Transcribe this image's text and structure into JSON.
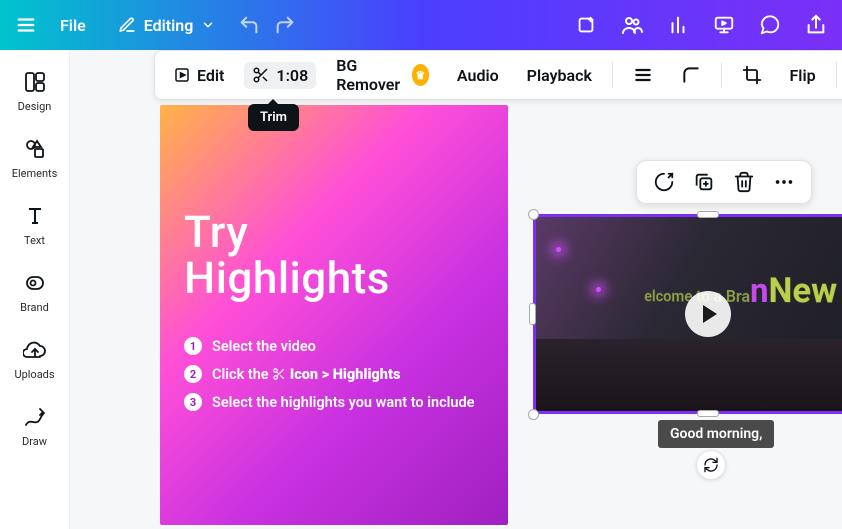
{
  "topbar": {
    "file_label": "File",
    "editing_label": "Editing"
  },
  "contextbar": {
    "edit_label": "Edit",
    "trim_time": "1:08",
    "bg_remover_label": "BG Remover",
    "audio_label": "Audio",
    "playback_label": "Playback",
    "flip_label": "Flip",
    "tooltip": "Trim"
  },
  "leftnav": {
    "items": [
      {
        "id": "design",
        "label": "Design"
      },
      {
        "id": "elements",
        "label": "Elements"
      },
      {
        "id": "text",
        "label": "Text"
      },
      {
        "id": "brand",
        "label": "Brand"
      },
      {
        "id": "uploads",
        "label": "Uploads"
      },
      {
        "id": "draw",
        "label": "Draw"
      }
    ]
  },
  "page": {
    "title_l1": "Try",
    "title_l2": "Highlights",
    "steps": [
      {
        "n": "1",
        "text": "Select the video"
      },
      {
        "n": "2",
        "prefix": "Click the",
        "bold": "Icon > Highlights"
      },
      {
        "n": "3",
        "text": "Select the highlights you want to include"
      }
    ]
  },
  "video": {
    "banner_small": "elcome to a Bra",
    "banner_big": "New Era",
    "caption": "Good morning,"
  }
}
